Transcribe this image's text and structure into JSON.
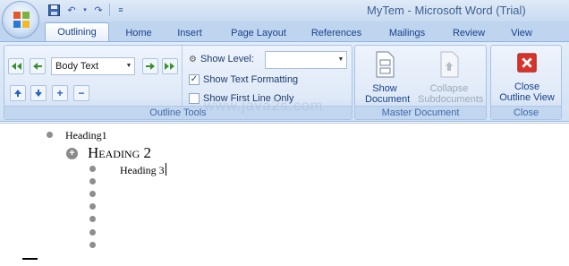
{
  "window": {
    "title": "MyTem - Microsoft Word (Trial)"
  },
  "tabs": [
    {
      "label": "Outlining"
    },
    {
      "label": "Home"
    },
    {
      "label": "Insert"
    },
    {
      "label": "Page Layout"
    },
    {
      "label": "References"
    },
    {
      "label": "Mailings"
    },
    {
      "label": "Review"
    },
    {
      "label": "View"
    }
  ],
  "outline_tools": {
    "group_label": "Outline Tools",
    "level_value": "Body Text",
    "show_level_label": "Show Level:",
    "show_level_value": "",
    "show_text_formatting": {
      "label": "Show Text Formatting",
      "checked": true
    },
    "show_first_line_only": {
      "label": "Show First Line Only",
      "checked": false
    }
  },
  "master_document": {
    "group_label": "Master Document",
    "show_document": "Show Document",
    "collapse_subdocuments": "Collapse Subdocuments"
  },
  "close": {
    "group_label": "Close",
    "close_outline_view": "Close Outline View"
  },
  "document": {
    "watermark": "www.java2s.com",
    "headings": [
      {
        "level": 1,
        "text": "Heading1"
      },
      {
        "level": 2,
        "text": "Heading 2"
      },
      {
        "level": 3,
        "text": "Heading 3"
      }
    ],
    "empty_body_bullets": 6
  },
  "colors": {
    "ribbon_bg": "#dfe9f7",
    "close_icon": "#d9342b",
    "text_accent": "#15428b"
  }
}
